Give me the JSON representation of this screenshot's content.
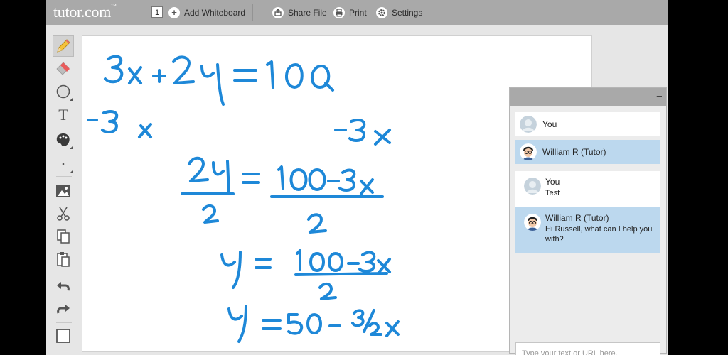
{
  "app": {
    "logo": "tutor.com",
    "logo_tm": "™"
  },
  "topbar": {
    "page_number": "1",
    "add_whiteboard": "Add Whiteboard",
    "share_file": "Share File",
    "print": "Print",
    "settings": "Settings"
  },
  "tools": [
    "pencil-icon",
    "eraser-icon",
    "circle-shape-icon",
    "text-icon",
    "color-palette-icon",
    "line-width-icon",
    "image-icon",
    "scissors-icon",
    "copy-icon",
    "paste-icon",
    "undo-icon",
    "redo-icon",
    "background-icon"
  ],
  "whiteboard": {
    "ink_color": "#1e88d8",
    "lines": [
      "3x+2y=100",
      "-3x",
      "-3x",
      "2y = 100-3x",
      "2",
      "2",
      "y = 100-3x",
      "2",
      "y =50 - 3/2x"
    ]
  },
  "chat": {
    "minimize": "–",
    "participants": [
      {
        "name": "You"
      },
      {
        "name": "William R (Tutor)"
      }
    ],
    "messages": [
      {
        "sender": "You",
        "text": "Test"
      },
      {
        "sender": "William R (Tutor)",
        "text": "Hi Russell, what can I help you with?"
      }
    ],
    "input_placeholder": "Type your text or URL here."
  },
  "colors": {
    "topbar": "#a9a9a9",
    "tutor_highlight": "#bcd8ee",
    "ink": "#1e88d8"
  }
}
